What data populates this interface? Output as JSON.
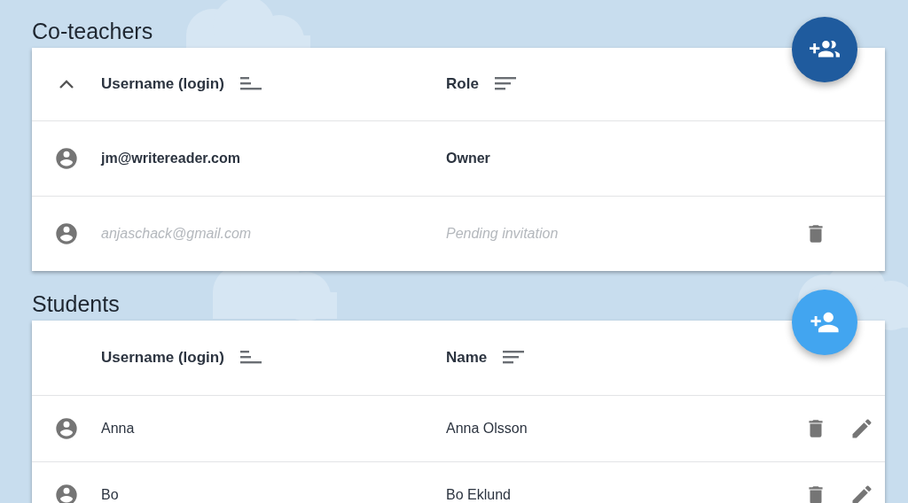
{
  "sections": [
    {
      "title": "Co-teachers",
      "fab": {
        "kind": "add-group",
        "color": "#1f5b9e"
      },
      "expanded": true,
      "columns": [
        {
          "label": "Username (login)",
          "kind": "ascending"
        },
        {
          "label": "Role",
          "kind": "descending"
        }
      ],
      "rows": [
        {
          "username": "jm@writereader.com",
          "detail": "Owner",
          "pending": false
        },
        {
          "username": "anjaschack@gmail.com",
          "detail": "Pending invitation",
          "pending": true,
          "actions": [
            {
              "kind": "delete"
            }
          ]
        }
      ]
    },
    {
      "title": "Students",
      "fab": {
        "kind": "add-person",
        "color": "#42a5f0"
      },
      "columns": [
        {
          "label": "Username (login)",
          "kind": "ascending"
        },
        {
          "label": "Name",
          "kind": "descending"
        }
      ],
      "rows": [
        {
          "username": "Anna",
          "detail": "Anna Olsson",
          "pending": false,
          "actions": [
            {
              "kind": "delete"
            },
            {
              "kind": "edit"
            }
          ]
        },
        {
          "username": "Bo",
          "detail": "Bo Eklund",
          "pending": false,
          "actions": [
            {
              "kind": "delete"
            },
            {
              "kind": "edit"
            }
          ]
        }
      ]
    }
  ]
}
